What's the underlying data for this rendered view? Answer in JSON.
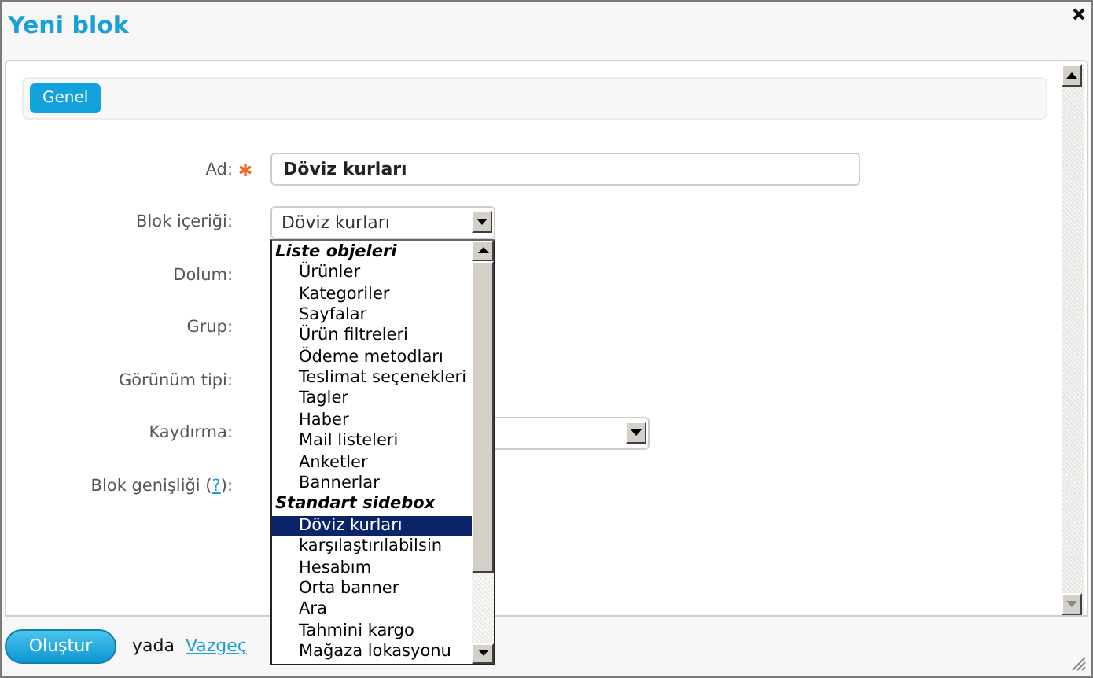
{
  "window": {
    "title": "Yeni blok"
  },
  "tabs": [
    {
      "label": "Genel",
      "selected": true
    }
  ],
  "form": {
    "rows": [
      {
        "label": "Ad:",
        "required": true,
        "kind": "text",
        "value": "Döviz kurları"
      },
      {
        "label": "Blok içeriği:",
        "required": false,
        "kind": "select",
        "value": "Döviz kurları",
        "options": [
          {
            "kind": "group",
            "label": "Liste objeleri"
          },
          {
            "kind": "option",
            "label": "Ürünler",
            "selected": false
          },
          {
            "kind": "option",
            "label": "Kategoriler",
            "selected": false
          },
          {
            "kind": "option",
            "label": "Sayfalar",
            "selected": false
          },
          {
            "kind": "option",
            "label": "Ürün filtreleri",
            "selected": false
          },
          {
            "kind": "option",
            "label": "Ödeme metodları",
            "selected": false
          },
          {
            "kind": "option",
            "label": "Teslimat seçenekleri",
            "selected": false
          },
          {
            "kind": "option",
            "label": "Tagler",
            "selected": false
          },
          {
            "kind": "option",
            "label": "Haber",
            "selected": false
          },
          {
            "kind": "option",
            "label": "Mail listeleri",
            "selected": false
          },
          {
            "kind": "option",
            "label": "Anketler",
            "selected": false
          },
          {
            "kind": "option",
            "label": "Bannerlar",
            "selected": false
          },
          {
            "kind": "group",
            "label": "Standart sidebox"
          },
          {
            "kind": "option",
            "label": "Döviz kurları",
            "selected": true
          },
          {
            "kind": "option",
            "label": "karşılaştırılabilsin",
            "selected": false
          },
          {
            "kind": "option",
            "label": "Hesabım",
            "selected": false
          },
          {
            "kind": "option",
            "label": "Orta banner",
            "selected": false
          },
          {
            "kind": "option",
            "label": "Ara",
            "selected": false
          },
          {
            "kind": "option",
            "label": "Tahmini kargo",
            "selected": false
          },
          {
            "kind": "option",
            "label": "Mağaza lokasyonu",
            "selected": false
          }
        ]
      },
      {
        "label": "Dolum:",
        "required": false,
        "kind": "covered"
      },
      {
        "label": "Grup:",
        "required": false,
        "kind": "covered"
      },
      {
        "label": "Görünüm tipi:",
        "required": false,
        "kind": "covered"
      },
      {
        "label": "Kaydırma:",
        "required": false,
        "kind": "wide-select"
      },
      {
        "label": "Blok genişliği (",
        "help_link": "?",
        "label_end": "):",
        "required": false,
        "kind": "covered"
      }
    ]
  },
  "footer": {
    "submit": "Oluştur",
    "separator": "yada",
    "cancel": "Vazgeç"
  }
}
